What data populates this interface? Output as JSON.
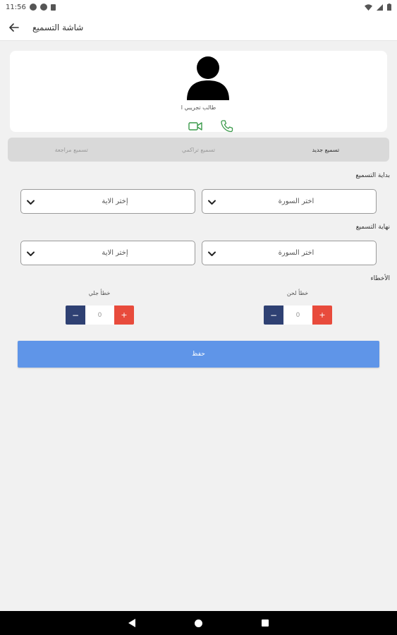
{
  "status_bar": {
    "time": "11:56"
  },
  "app_bar": {
    "title": "شاشة التسميع"
  },
  "profile": {
    "student_name": "طالب تجريبي ا"
  },
  "tabs": [
    {
      "label": "تسميع جديد",
      "active": true
    },
    {
      "label": "تسميع تراكمي",
      "active": false
    },
    {
      "label": "تسميع مراجعة",
      "active": false
    }
  ],
  "recitation_start": {
    "label": "بداية التسميع",
    "surah_value": "اختر السورة",
    "ayah_value": "إختر الاية"
  },
  "recitation_end": {
    "label": "نهاية التسميع",
    "surah_value": "اختر السورة",
    "ayah_value": "إختر الاية"
  },
  "errors": {
    "label": "الأخطاء",
    "minor_error": {
      "label": "خطأ لحن",
      "value": "0",
      "minus": "−",
      "plus": "+"
    },
    "major_error": {
      "label": "خطأ جلي",
      "value": "0",
      "minus": "−",
      "plus": "+"
    }
  },
  "save_button": {
    "label": "حفظ"
  },
  "colors": {
    "primary": "#5f95e8",
    "minus_button": "#2f4173",
    "plus_button": "#e84b3c",
    "icon_green": "#3a9a4a"
  }
}
